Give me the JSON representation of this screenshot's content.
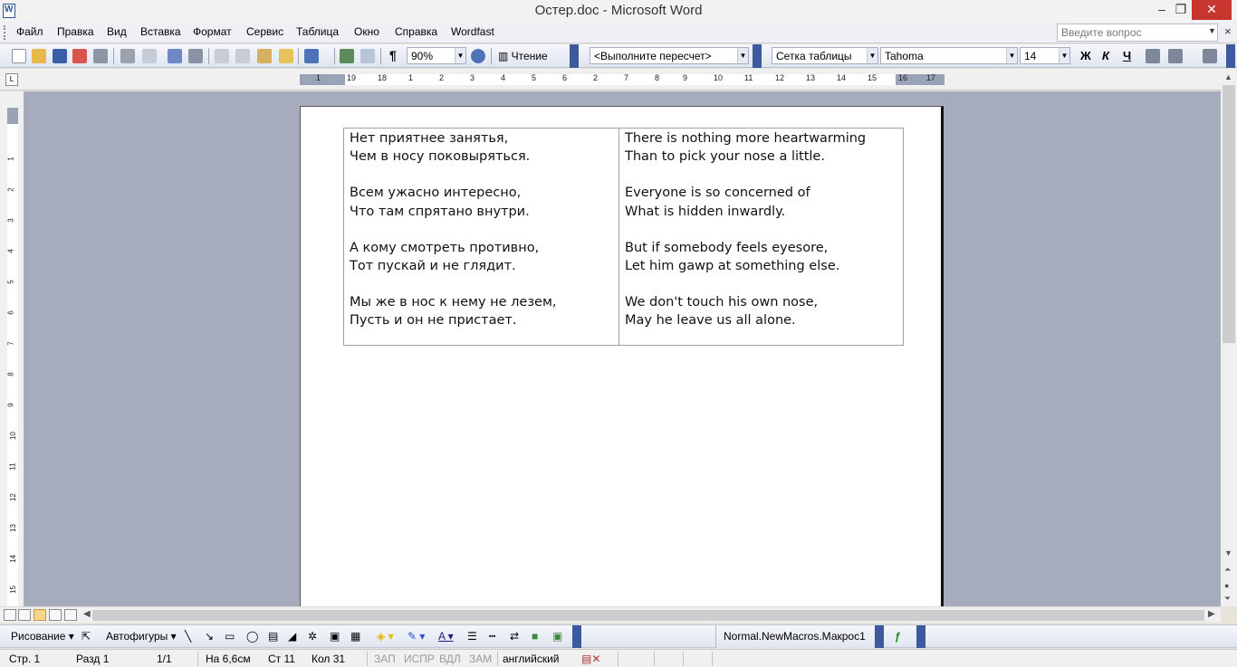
{
  "window": {
    "title": "Остер.doc - Microsoft Word",
    "minimize": "–",
    "maximize": "❐",
    "close": "✕"
  },
  "menu": {
    "items": [
      "Файл",
      "Правка",
      "Вид",
      "Вставка",
      "Формат",
      "Сервис",
      "Таблица",
      "Окно",
      "Справка",
      "Wordfast"
    ],
    "ask_placeholder": "Введите вопрос",
    "close": "×"
  },
  "toolbar": {
    "zoom": "90%",
    "read_mode": "Чтение",
    "paragraph_mark": "¶",
    "field_combo": "<Выполните пересчет>",
    "style": "Сетка таблицы",
    "font": "Tahoma",
    "size": "14",
    "bold": "Ж",
    "italic": "К",
    "underline": "Ч"
  },
  "ruler": {
    "marks": [
      "1",
      "2",
      "1",
      "2",
      "3",
      "4",
      "5",
      "6",
      "7",
      "8",
      "9",
      "10",
      "11",
      "12",
      "13",
      "14",
      "15",
      "16",
      "17",
      "18",
      "19"
    ],
    "corner": "L",
    "vertical_marks": [
      "1",
      "2",
      "3",
      "4",
      "5",
      "6",
      "7",
      "8",
      "9",
      "10",
      "11",
      "12",
      "13",
      "14",
      "15"
    ]
  },
  "document": {
    "left_column": [
      [
        "Нет приятнее занятья,",
        "Чем в носу поковыряться."
      ],
      [
        "Всем ужасно интересно,",
        "Что там спрятано внутри."
      ],
      [
        "А кому смотреть противно,",
        "Тот пускай и не глядит."
      ],
      [
        "Мы же в нос к нему не лезем,",
        "Пусть и он не пристает."
      ]
    ],
    "right_column": [
      [
        "There is nothing more heartwarming",
        "Than to pick your nose a little."
      ],
      [
        "Everyone is so concerned of",
        "What is hidden inwardly."
      ],
      [
        "But if somebody feels eyesore,",
        "Let him gawp at something else."
      ],
      [
        "We don't touch his own nose,",
        "May he leave us all alone."
      ]
    ]
  },
  "drawing_toolbar": {
    "draw": "Рисование",
    "autoshapes": "Автофигуры",
    "macro": "Normal.NewMacros.Макрос1"
  },
  "status": {
    "page": "Стр. 1",
    "section": "Разд 1",
    "pages": "1/1",
    "at": "На 6,6см",
    "line": "Ст 11",
    "col": "Кол 31",
    "rec": "ЗАП",
    "trk": "ИСПР",
    "ext": "ВДЛ",
    "ovr": "ЗАМ",
    "language": "английский"
  },
  "colors": {
    "workspace": "#a7acbc",
    "close_button": "#c7372f",
    "toolbar_accent": "#3d5a9e"
  }
}
